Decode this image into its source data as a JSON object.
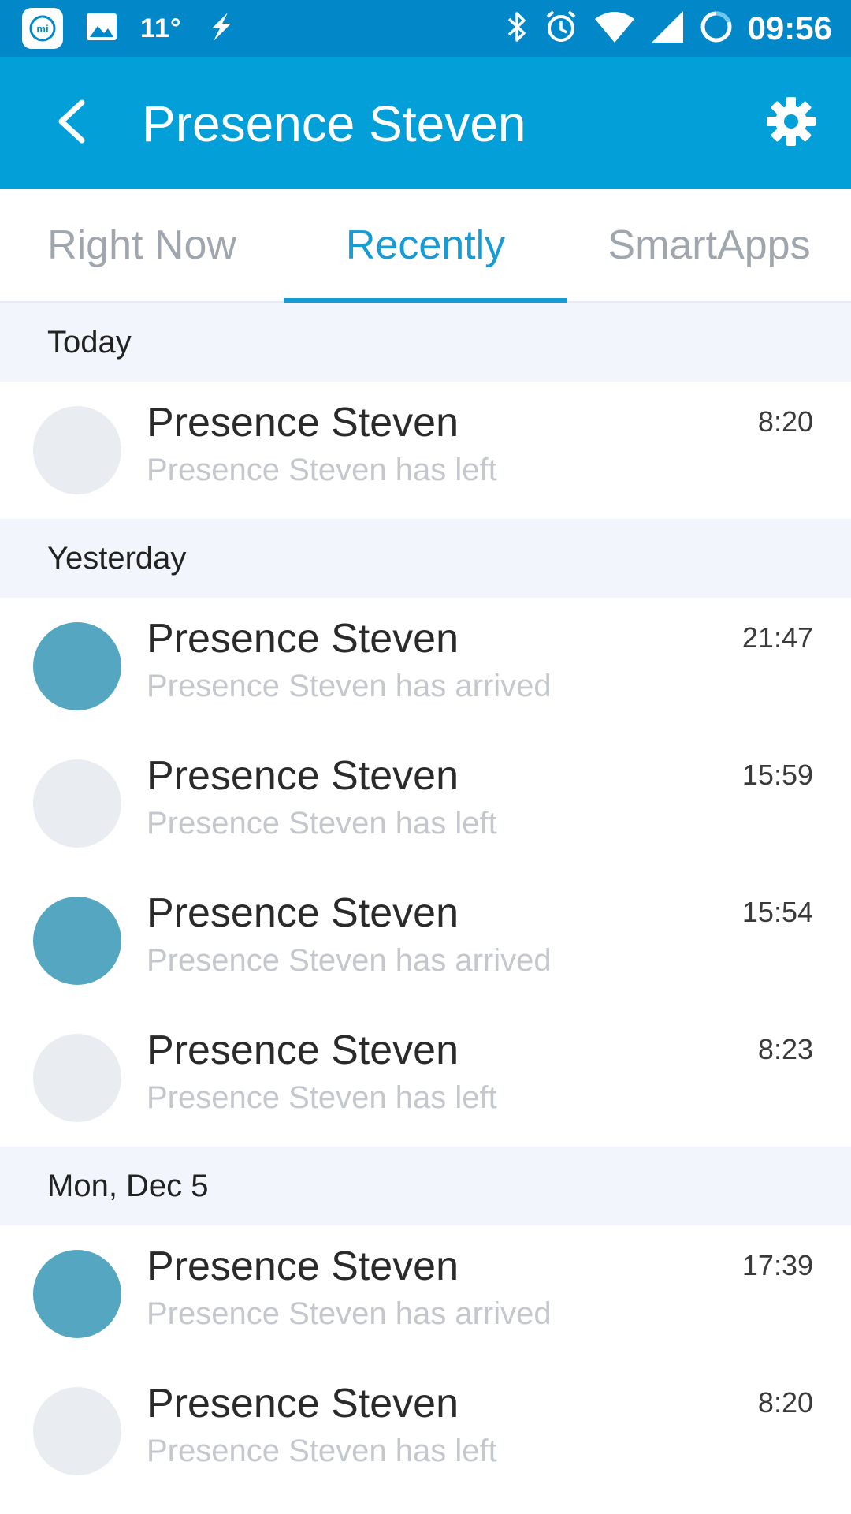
{
  "statusbar": {
    "temperature": "11°",
    "clock": "09:56"
  },
  "appbar": {
    "title": "Presence Steven"
  },
  "tabs": [
    {
      "label": "Right Now",
      "active": false
    },
    {
      "label": "Recently",
      "active": true
    },
    {
      "label": "SmartApps",
      "active": false
    }
  ],
  "sections": [
    {
      "header": "Today",
      "events": [
        {
          "title": "Presence Steven",
          "subtitle": "Presence Steven has left",
          "time": "8:20",
          "state": "left"
        }
      ]
    },
    {
      "header": "Yesterday",
      "events": [
        {
          "title": "Presence Steven",
          "subtitle": "Presence Steven has arrived",
          "time": "21:47",
          "state": "arrived"
        },
        {
          "title": "Presence Steven",
          "subtitle": "Presence Steven has left",
          "time": "15:59",
          "state": "left"
        },
        {
          "title": "Presence Steven",
          "subtitle": "Presence Steven has arrived",
          "time": "15:54",
          "state": "arrived"
        },
        {
          "title": "Presence Steven",
          "subtitle": "Presence Steven has left",
          "time": "8:23",
          "state": "left"
        }
      ]
    },
    {
      "header": "Mon, Dec 5",
      "events": [
        {
          "title": "Presence Steven",
          "subtitle": "Presence Steven has arrived",
          "time": "17:39",
          "state": "arrived"
        },
        {
          "title": "Presence Steven",
          "subtitle": "Presence Steven has left",
          "time": "8:20",
          "state": "left"
        }
      ]
    }
  ],
  "colors": {
    "statusbar": "#0288c8",
    "appbar": "#039fd9",
    "accent": "#169bd5",
    "arrived_avatar": "#55a7c1",
    "left_avatar": "#e9ecf0"
  },
  "icons": {
    "status_left": [
      "mi-logo-icon",
      "gallery-icon",
      "flash-icon"
    ],
    "status_right": [
      "bluetooth-icon",
      "alarm-icon",
      "wifi-icon",
      "signal-icon",
      "battery-ring-icon"
    ],
    "back": "chevron-left-icon",
    "settings": "gear-icon"
  }
}
